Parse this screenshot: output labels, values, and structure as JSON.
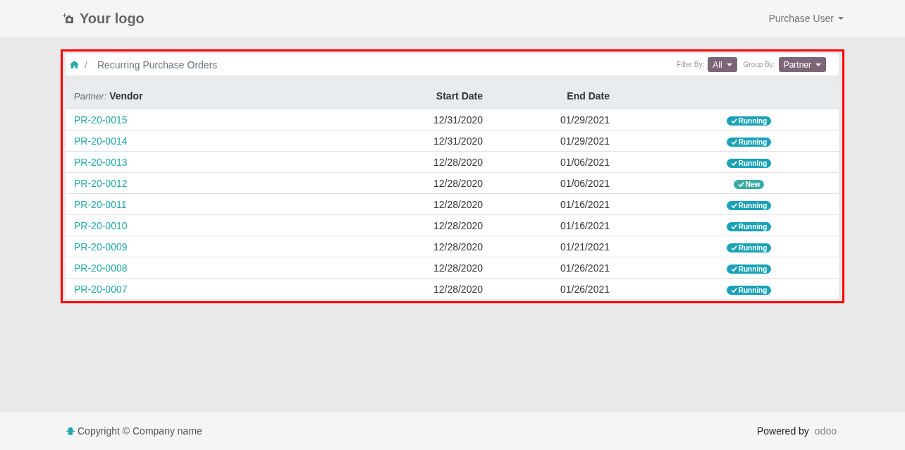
{
  "header": {
    "logo": "Your logo",
    "user_menu": "Purchase User"
  },
  "breadcrumb": {
    "separator": "/",
    "current": "Recurring Purchase Orders"
  },
  "filters": [
    {
      "label": "Filter By:",
      "value": "All"
    },
    {
      "label": "Group By:",
      "value": "Partner"
    }
  ],
  "table": {
    "group": {
      "label": "Partner:",
      "value": "Vendor"
    },
    "columns": [
      "Start Date",
      "End Date"
    ],
    "rows": [
      {
        "ref": "PR-20-0015",
        "start": "12/31/2020",
        "end": "01/29/2021",
        "status": {
          "kind": "running",
          "label": "Running"
        }
      },
      {
        "ref": "PR-20-0014",
        "start": "12/31/2020",
        "end": "01/29/2021",
        "status": {
          "kind": "running",
          "label": "Running"
        }
      },
      {
        "ref": "PR-20-0013",
        "start": "12/28/2020",
        "end": "01/06/2021",
        "status": {
          "kind": "running",
          "label": "Running"
        }
      },
      {
        "ref": "PR-20-0012",
        "start": "12/28/2020",
        "end": "01/06/2021",
        "status": {
          "kind": "new",
          "label": "New"
        }
      },
      {
        "ref": "PR-20-0011",
        "start": "12/28/2020",
        "end": "01/16/2021",
        "status": {
          "kind": "running",
          "label": "Running"
        }
      },
      {
        "ref": "PR-20-0010",
        "start": "12/28/2020",
        "end": "01/16/2021",
        "status": {
          "kind": "running",
          "label": "Running"
        }
      },
      {
        "ref": "PR-20-0009",
        "start": "12/28/2020",
        "end": "01/21/2021",
        "status": {
          "kind": "running",
          "label": "Running"
        }
      },
      {
        "ref": "PR-20-0008",
        "start": "12/28/2020",
        "end": "01/26/2021",
        "status": {
          "kind": "running",
          "label": "Running"
        }
      },
      {
        "ref": "PR-20-0007",
        "start": "12/28/2020",
        "end": "01/26/2021",
        "status": {
          "kind": "running",
          "label": "Running"
        }
      }
    ]
  },
  "footer": {
    "copyright": "Copyright © Company name",
    "powered_by": "Powered by",
    "brand": "odoo"
  }
}
